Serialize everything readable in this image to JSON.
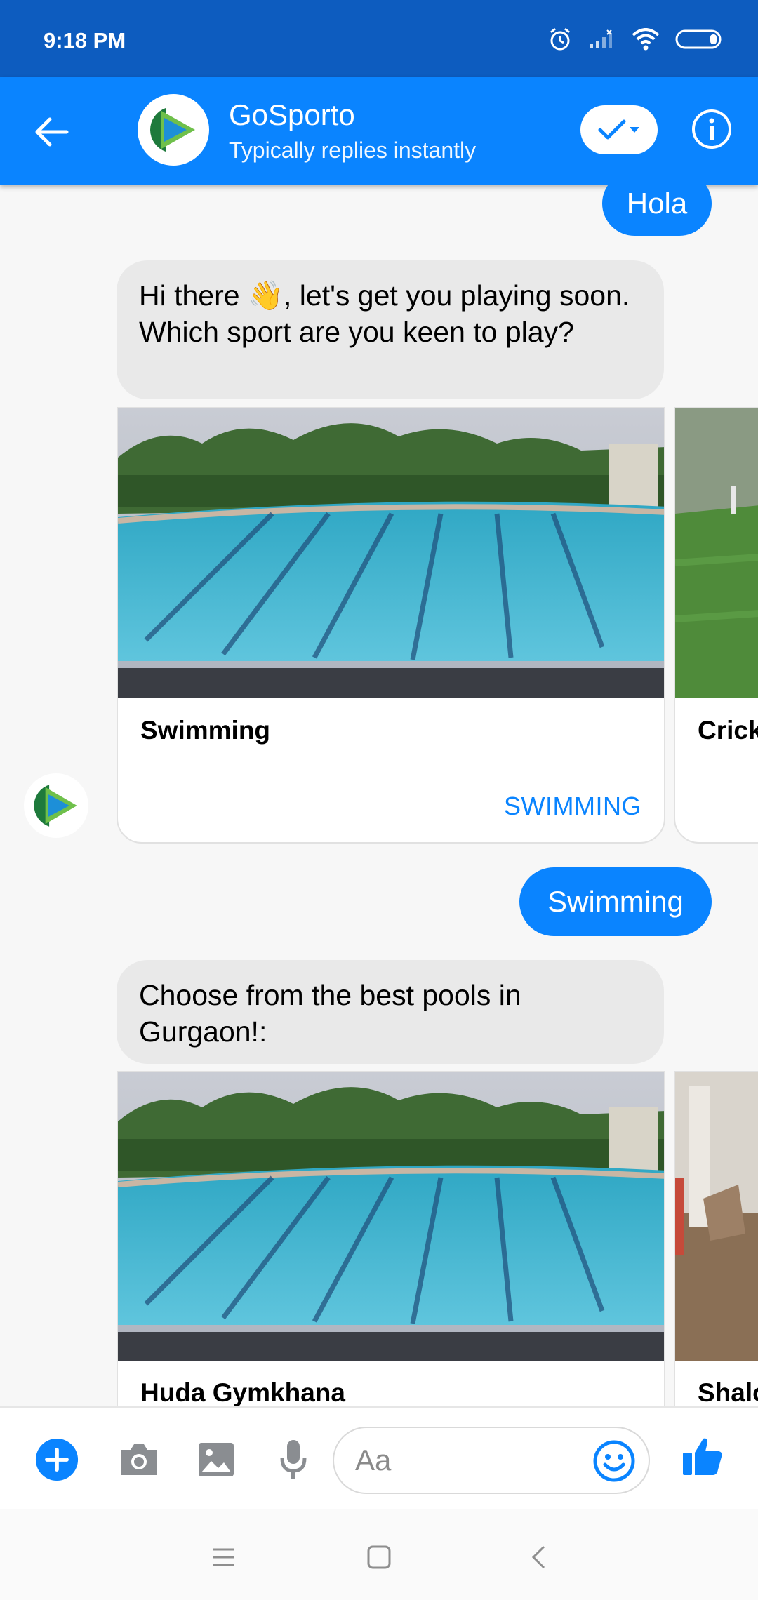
{
  "status_bar": {
    "time": "9:18 PM"
  },
  "header": {
    "title": "GoSporto",
    "subtitle": "Typically replies instantly"
  },
  "messages": {
    "user_1": "Hola",
    "bot_1": "Hi there 👋, let's get you playing soon. Which sport are you keen to play?",
    "user_2": "Swimming",
    "bot_2": "Choose from the best pools in Gurgaon!:"
  },
  "carousel_1": {
    "cards": [
      {
        "title": "Swimming",
        "action": "SWIMMING"
      },
      {
        "title": "Crick"
      }
    ]
  },
  "carousel_2": {
    "cards": [
      {
        "title": "Huda Gymkhana"
      },
      {
        "title": "Shalo"
      }
    ]
  },
  "composer": {
    "placeholder": "Aa"
  },
  "colors": {
    "accent": "#0a84ff",
    "status_bar": "#0d5cbf",
    "bot_bubble": "#e9e9e9"
  }
}
